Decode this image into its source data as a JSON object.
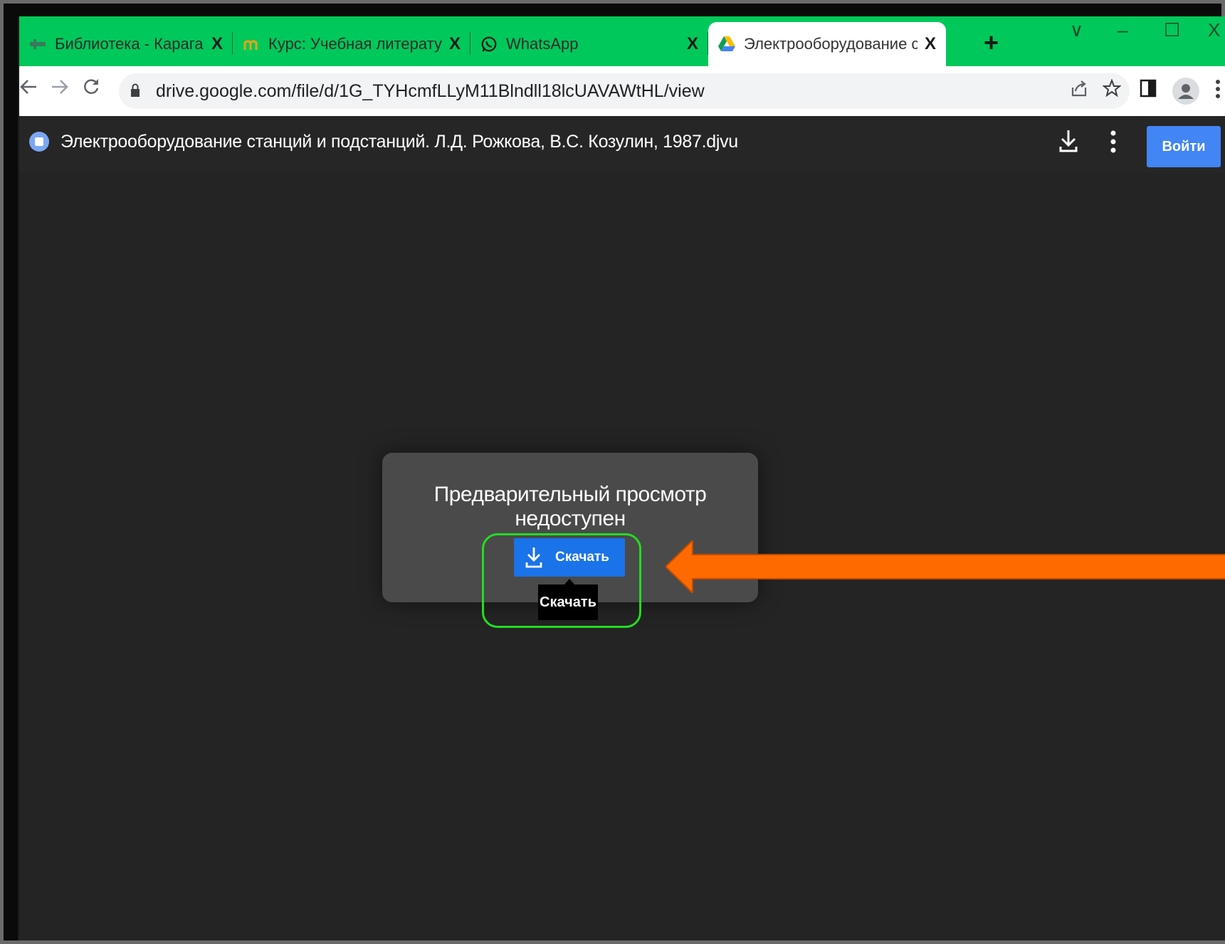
{
  "tabs": [
    {
      "title": "Библиотека - Карагандинский",
      "close": "X",
      "favicon": "library-icon"
    },
    {
      "title": "Курс: Учебная литература по с",
      "close": "X",
      "favicon": "moodle-icon"
    },
    {
      "title": "WhatsApp",
      "close": "X",
      "favicon": "whatsapp-icon"
    },
    {
      "title": "Электрооборудование станци",
      "close": "X",
      "favicon": "google-drive-icon",
      "active": true
    }
  ],
  "new_tab": "+",
  "window_controls": {
    "tab_search": "∨",
    "minimize": "–",
    "maximize": "☐",
    "close": "X"
  },
  "address_bar": {
    "url": "drive.google.com/file/d/1G_TYHcmfLLyM11Blndll18lcUAVAWtHL/view"
  },
  "viewer": {
    "file_name": "Электрооборудование станций и подстанций. Л.Д. Рожкова, В.С. Козулин, 1987.djvu",
    "signin_label": "Войти"
  },
  "dialog": {
    "message": "Предварительный просмотр недоступен",
    "download_label": "Скачать",
    "tooltip": "Скачать"
  },
  "colors": {
    "tab_strip": "#00c85a",
    "accent_blue": "#1a73e8",
    "signin_blue": "#4285f4",
    "highlight_green": "#22dd22",
    "arrow_orange": "#ff6a00"
  }
}
